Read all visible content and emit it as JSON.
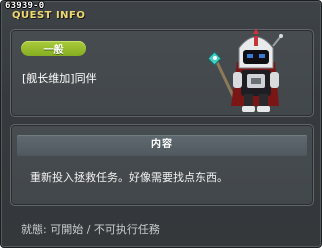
{
  "window": {
    "quest_id": "63939-0",
    "title": "QUEST INFO"
  },
  "quest": {
    "category": "一般",
    "name": "[舰长维加]同伴"
  },
  "content": {
    "header": "内容",
    "description": "重新投入拯救任务。好像需要找点东西。"
  },
  "status": {
    "text": "就態: 可開始 / 不可执行任務"
  },
  "colors": {
    "title": "#f0d870",
    "badge": "#9abf2e",
    "panel": "#45494d",
    "section_bar": "#56626a"
  },
  "icons": [
    "npc-portrait-icon"
  ]
}
